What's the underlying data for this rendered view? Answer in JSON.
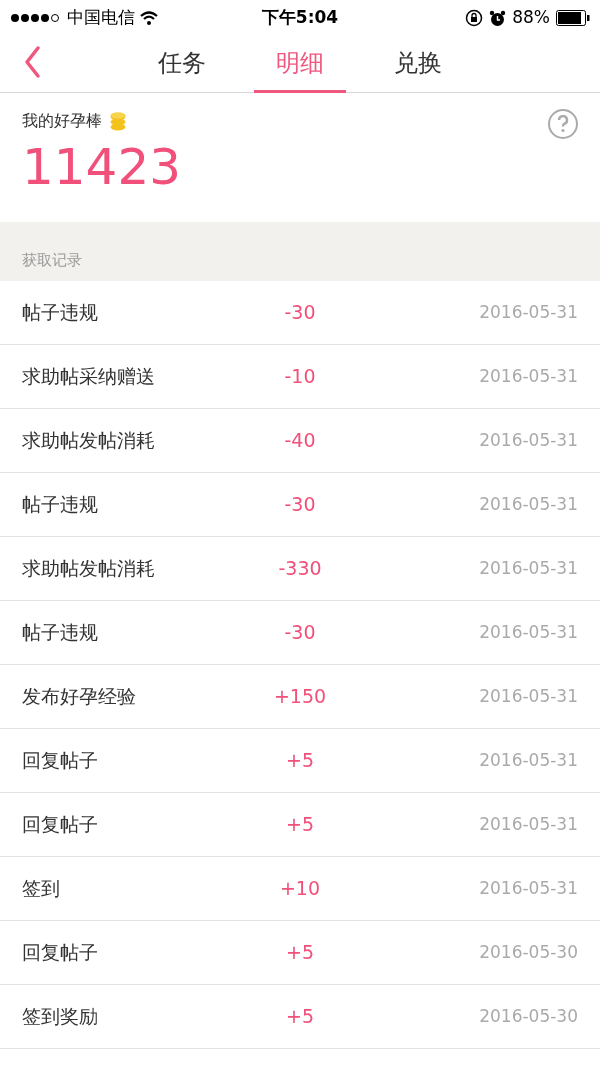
{
  "status_bar": {
    "carrier": "中国电信",
    "time": "下午5:04",
    "battery": "88%"
  },
  "tabs": [
    {
      "label": "任务",
      "selected": false
    },
    {
      "label": "明细",
      "selected": true
    },
    {
      "label": "兑换",
      "selected": false
    }
  ],
  "balance": {
    "label": "我的好孕棒",
    "value": "11423"
  },
  "section_title": "获取记录",
  "records": [
    {
      "name": "帖子违规",
      "amount": "-30",
      "date": "2016-05-31"
    },
    {
      "name": "求助帖采纳赠送",
      "amount": "-10",
      "date": "2016-05-31"
    },
    {
      "name": "求助帖发帖消耗",
      "amount": "-40",
      "date": "2016-05-31"
    },
    {
      "name": "帖子违规",
      "amount": "-30",
      "date": "2016-05-31"
    },
    {
      "name": "求助帖发帖消耗",
      "amount": "-330",
      "date": "2016-05-31"
    },
    {
      "name": "帖子违规",
      "amount": "-30",
      "date": "2016-05-31"
    },
    {
      "name": "发布好孕经验",
      "amount": "+150",
      "date": "2016-05-31"
    },
    {
      "name": "回复帖子",
      "amount": "+5",
      "date": "2016-05-31"
    },
    {
      "name": "回复帖子",
      "amount": "+5",
      "date": "2016-05-31"
    },
    {
      "name": "签到",
      "amount": "+10",
      "date": "2016-05-31"
    },
    {
      "name": "回复帖子",
      "amount": "+5",
      "date": "2016-05-30"
    },
    {
      "name": "签到奖励",
      "amount": "+5",
      "date": "2016-05-30"
    }
  ]
}
